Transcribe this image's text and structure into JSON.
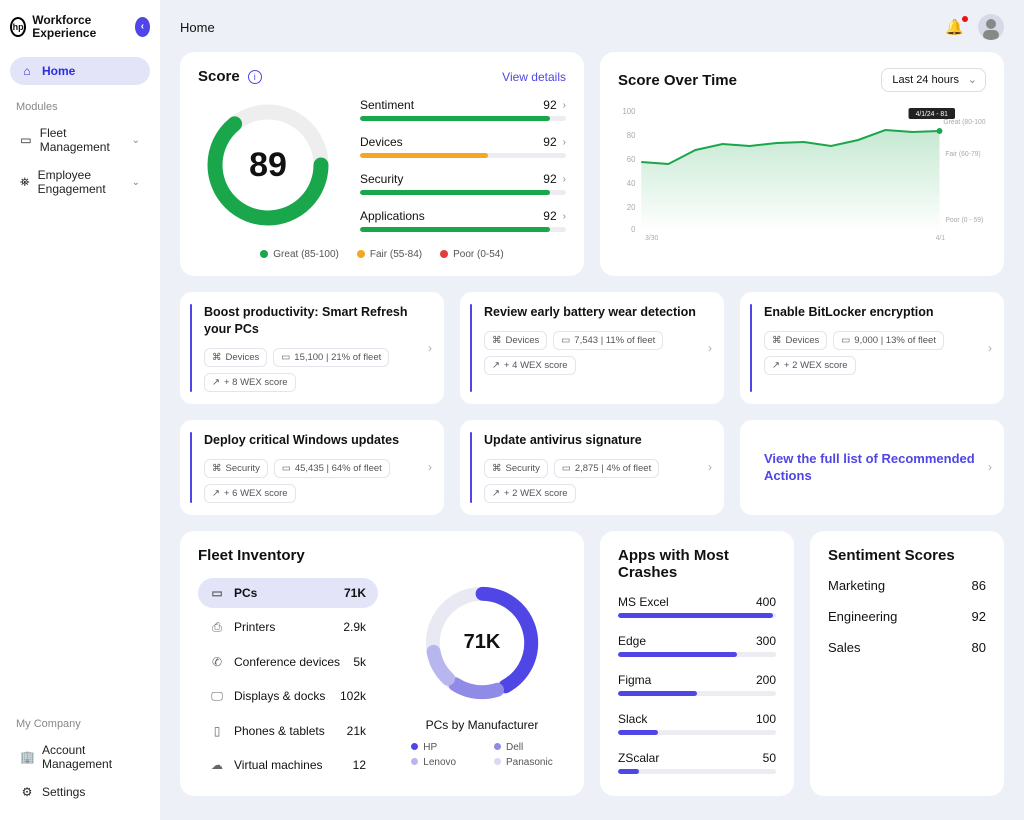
{
  "brand": "Workforce Experience",
  "topbar": {
    "title": "Home"
  },
  "sidebar": {
    "home_label": "Home",
    "modules_label": "Modules",
    "fleet_mgmt_label": "Fleet Management",
    "emp_eng_label": "Employee Engagement",
    "mycompany_label": "My Company",
    "account_label": "Account Management",
    "settings_label": "Settings"
  },
  "score": {
    "title": "Score",
    "view_details": "View details",
    "value": "89",
    "metrics": [
      {
        "label": "Sentiment",
        "value": "92",
        "pct": 92,
        "color": "#1aa64a"
      },
      {
        "label": "Devices",
        "value": "92",
        "pct": 62,
        "color": "#f5a623"
      },
      {
        "label": "Security",
        "value": "92",
        "pct": 92,
        "color": "#1aa64a"
      },
      {
        "label": "Applications",
        "value": "92",
        "pct": 92,
        "color": "#1aa64a"
      }
    ],
    "legend": {
      "great": "Great (85-100)",
      "fair": "Fair (55-84)",
      "poor": "Poor (0-54)"
    }
  },
  "sot": {
    "title": "Score Over Time",
    "range": "Last 24 hours",
    "tooltip_date": "4/1/24 - 81",
    "bands": {
      "great": "Great (80-100)",
      "fair": "Fair (60-79)",
      "poor": "Poor (0 - 59)"
    },
    "x_start": "3/30",
    "x_end": "4/1"
  },
  "recos": [
    {
      "title": "Boost productivity: Smart Refresh your PCs",
      "cat": "Devices",
      "stat": "15,100 | 21% of fleet",
      "impact": "+ 8 WEX score"
    },
    {
      "title": "Review early battery wear detection",
      "cat": "Devices",
      "stat": "7,543 | 11% of fleet",
      "impact": "+ 4 WEX score"
    },
    {
      "title": "Enable BitLocker encryption",
      "cat": "Devices",
      "stat": "9,000 | 13% of fleet",
      "impact": "+ 2 WEX score"
    },
    {
      "title": "Deploy critical Windows updates",
      "cat": "Security",
      "stat": "45,435 | 64% of fleet",
      "impact": "+ 6 WEX score"
    },
    {
      "title": "Update antivirus signature",
      "cat": "Security",
      "stat": "2,875 | 4% of fleet",
      "impact": "+ 2 WEX score"
    }
  ],
  "reco_link": "View the full list of Recommended Actions",
  "fleet": {
    "title": "Fleet Inventory",
    "items": [
      {
        "label": "PCs",
        "count": "71K",
        "icon": "▭"
      },
      {
        "label": "Printers",
        "count": "2.9k",
        "icon": "⎙"
      },
      {
        "label": "Conference devices",
        "count": "5k",
        "icon": "✆"
      },
      {
        "label": "Displays & docks",
        "count": "102k",
        "icon": "🖵"
      },
      {
        "label": "Phones & tablets",
        "count": "21k",
        "icon": "▯"
      },
      {
        "label": "Virtual machines",
        "count": "12",
        "icon": "☁"
      }
    ],
    "donut_center": "71K",
    "subtitle": "PCs by Manufacturer",
    "manufacturers": [
      {
        "label": "HP",
        "color": "#4f46e5"
      },
      {
        "label": "Dell",
        "color": "#8f8be6"
      },
      {
        "label": "Lenovo",
        "color": "#b8b6ee"
      },
      {
        "label": "Panasonic",
        "color": "#d9d8f5"
      }
    ]
  },
  "crashes": {
    "title": "Apps with Most Crashes",
    "items": [
      {
        "label": "MS Excel",
        "value": "400",
        "pct": 98
      },
      {
        "label": "Edge",
        "value": "300",
        "pct": 75
      },
      {
        "label": "Figma",
        "value": "200",
        "pct": 50
      },
      {
        "label": "Slack",
        "value": "100",
        "pct": 25
      },
      {
        "label": "ZScalar",
        "value": "50",
        "pct": 13
      }
    ]
  },
  "sentiment": {
    "title": "Sentiment Scores",
    "items": [
      {
        "label": "Marketing",
        "value": "86"
      },
      {
        "label": "Engineering",
        "value": "92"
      },
      {
        "label": "Sales",
        "value": "80"
      }
    ]
  },
  "chart_data": {
    "type": "line",
    "x": [
      "3/30",
      "",
      "",
      "",
      "",
      "",
      "",
      "",
      "",
      "4/1"
    ],
    "values": [
      57,
      55,
      66,
      71,
      70,
      72,
      73,
      70,
      75,
      82,
      80,
      81
    ],
    "title": "Score Over Time",
    "ylabel": "",
    "xlabel": "",
    "ylim": [
      0,
      100
    ],
    "y_ticks": [
      0,
      20,
      40,
      60,
      80,
      100
    ],
    "bands": [
      {
        "label": "Great",
        "range": [
          80,
          100
        ]
      },
      {
        "label": "Fair",
        "range": [
          60,
          79
        ]
      },
      {
        "label": "Poor",
        "range": [
          0,
          59
        ]
      }
    ],
    "tooltip": {
      "date": "4/1/24",
      "value": 81
    }
  }
}
